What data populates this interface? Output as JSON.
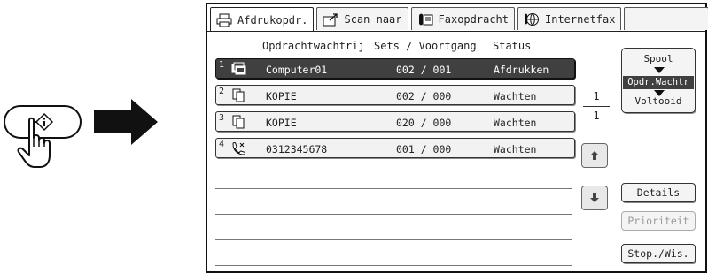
{
  "illustration": {
    "job_key_icon": "job-status-key-icon",
    "hand_icon": "pointing-hand-icon",
    "arrow_icon": "right-arrow-icon"
  },
  "tabs": [
    {
      "label": "Afdrukopdr.",
      "icon": "printer-icon",
      "active": true
    },
    {
      "label": "Scan naar",
      "icon": "scan-icon",
      "active": false
    },
    {
      "label": "Faxopdracht",
      "icon": "fax-icon",
      "active": false
    },
    {
      "label": "Internetfax",
      "icon": "internet-fax-icon",
      "active": false
    },
    {
      "label": "",
      "icon": "",
      "active": false
    }
  ],
  "columns": {
    "queue": "Opdrachtwachtrij",
    "sets": "Sets / Voortgang",
    "status": "Status"
  },
  "jobs": [
    {
      "num": "1",
      "icon": "computer-job-icon",
      "name": "Computer01",
      "sets": "002 / 001",
      "status": "Afdrukken",
      "selected": true
    },
    {
      "num": "2",
      "icon": "copy-job-icon",
      "name": "KOPIE",
      "sets": "002 / 000",
      "status": "Wachten",
      "selected": false
    },
    {
      "num": "3",
      "icon": "copy-job-icon",
      "name": "KOPIE",
      "sets": "020 / 000",
      "status": "Wachten",
      "selected": false
    },
    {
      "num": "4",
      "icon": "phone-job-icon",
      "name": "0312345678",
      "sets": "001 / 000",
      "status": "Wachten",
      "selected": false
    }
  ],
  "pager": {
    "current": "1",
    "total": "1"
  },
  "mode": {
    "spool": "Spool",
    "queue": "Opdr.Wachtr",
    "done": "Voltooid"
  },
  "buttons": {
    "details": "Details",
    "priority": "Prioriteit",
    "stop": "Stop./Wis."
  },
  "colors": {
    "selected_row": "#404040",
    "panel_border": "#111111"
  }
}
